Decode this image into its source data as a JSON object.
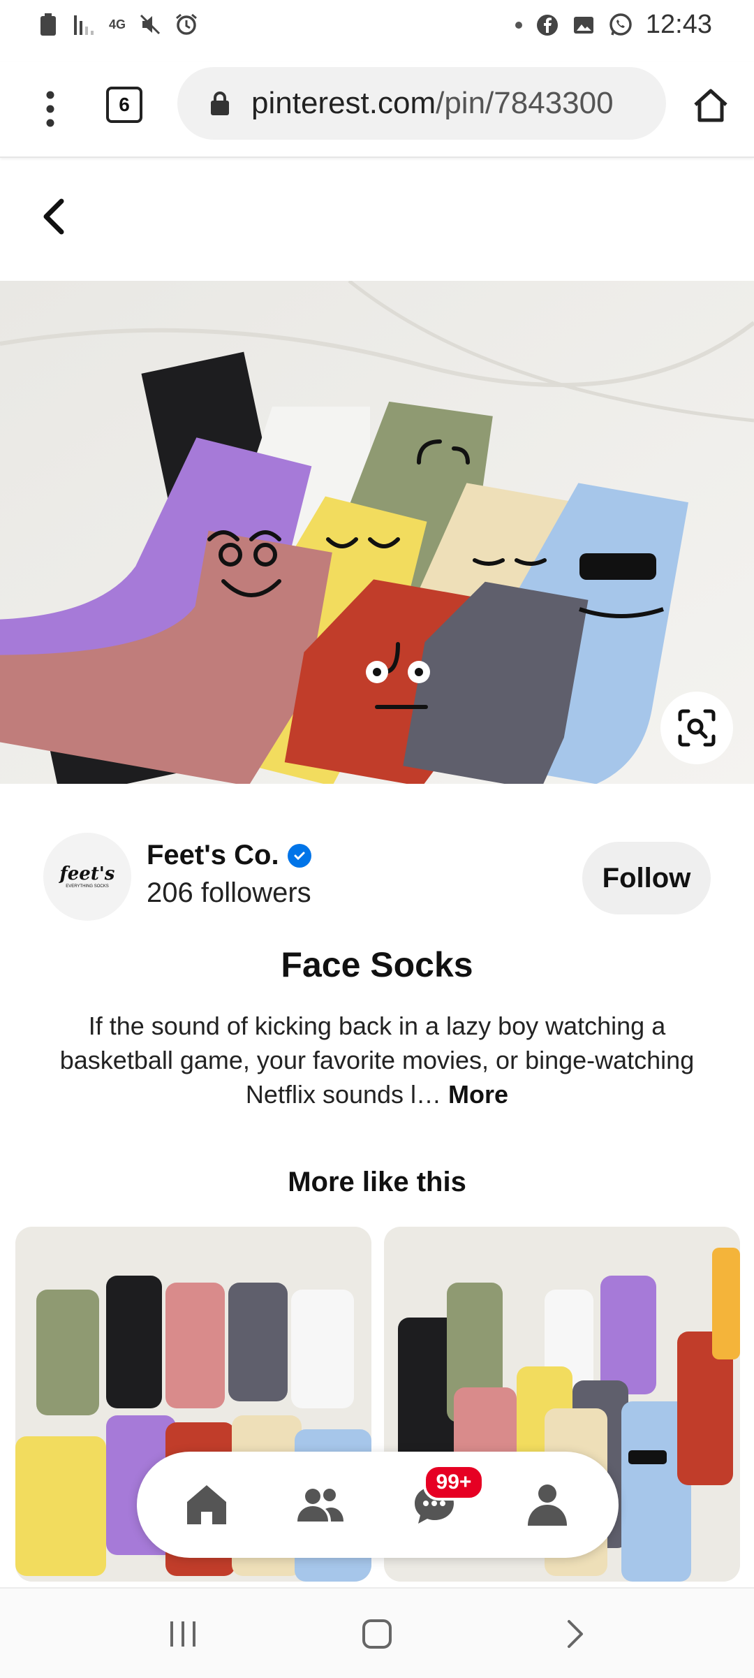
{
  "status_bar": {
    "time": "12:43",
    "network": "4G",
    "icons": [
      "battery-icon",
      "signal-icon",
      "mute-icon",
      "alarm-icon",
      "dot-icon",
      "facebook-icon",
      "gallery-icon",
      "whatsapp-icon"
    ]
  },
  "browser": {
    "tab_count": "6",
    "url_domain": "pinterest.com",
    "url_path": "/pin/7843300"
  },
  "pin": {
    "creator_name": "Feet's Co.",
    "avatar_text": "feet's",
    "avatar_subtext": "EVERYTHING SOCKS",
    "followers": "206 followers",
    "follow_label": "Follow",
    "title": "Face Socks",
    "description": "If the sound of kicking back in a lazy boy watching a basketball game, your favorite movies, or binge-watching Netflix sounds l…",
    "more_label": "More"
  },
  "more_like_this": "More like this",
  "bottom_nav": {
    "items": [
      "home-icon",
      "following-icon",
      "messages-icon",
      "profile-icon"
    ],
    "badge": "99+"
  },
  "colors": {
    "pinterest_red": "#e60023",
    "verified_blue": "#0074e8"
  }
}
